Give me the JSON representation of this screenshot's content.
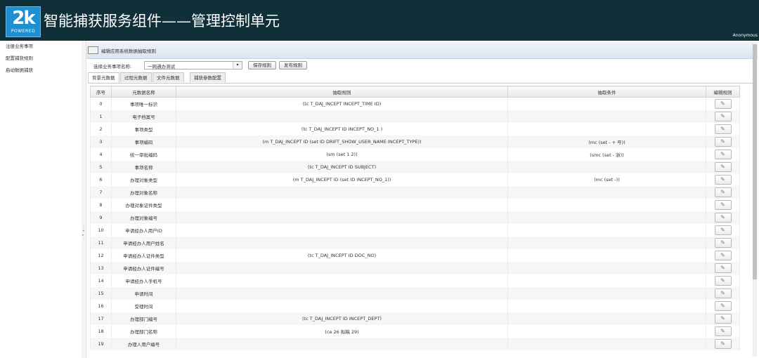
{
  "header": {
    "logo_mark": "2k",
    "logo_sub": "POWERED",
    "title": "智能捕获服务组件——管理控制单元",
    "user": "Anonymous"
  },
  "sidebar": {
    "items": [
      {
        "label": "注册业务事项"
      },
      {
        "label": "配置捕获规则"
      },
      {
        "label": "启动数据捕获"
      }
    ]
  },
  "panel": {
    "title": "编辑应用系统数据抽取规则"
  },
  "toolbar": {
    "select_label": "选择业务事项名称:",
    "select_value": "一网通办测试",
    "save_label": "保存规则",
    "publish_label": "发布规则"
  },
  "tabs": [
    {
      "label": "背景元数据",
      "active": true
    },
    {
      "label": "过程元数据",
      "active": false
    },
    {
      "label": "文件元数据",
      "active": false
    },
    {
      "label": "捕获参数配置",
      "active": false
    }
  ],
  "table": {
    "headers": [
      "序号",
      "元数据名称",
      "抽取规则",
      "抽取条件",
      "编辑规则"
    ],
    "edit_icon": "pencil-icon",
    "rows": [
      {
        "no": "0",
        "name": "事项唯一标识",
        "rule": "(tc T_DAJ_INCEPT INCEPT_TIME ID)",
        "cond": ""
      },
      {
        "no": "1",
        "name": "电子档案号",
        "rule": "",
        "cond": ""
      },
      {
        "no": "2",
        "name": "事项类型",
        "rule": "(tc T_DAJ_INCEPT ID INCEPT_NO_1 )",
        "cond": ""
      },
      {
        "no": "3",
        "name": "事项编码",
        "rule": "(m T_DAJ_INCEPT ID (set ID DRIFT_SHOW_USER_NAME INCEPT_TYPE))",
        "cond": "(mc (set - + 号))"
      },
      {
        "no": "4",
        "name": "统一审批编码",
        "rule": "(sm (set 1 2))",
        "cond": "(smc (set - 浙))"
      },
      {
        "no": "5",
        "name": "事项名称",
        "rule": "(tc T_DAJ_INCEPT ID SUBJECT)",
        "cond": ""
      },
      {
        "no": "6",
        "name": "办理对象类型",
        "rule": "(m T_DAJ_INCEPT ID (set ID INCEPT_NO_1))",
        "cond": "(mc (set -))"
      },
      {
        "no": "7",
        "name": "办理对象名称",
        "rule": "",
        "cond": ""
      },
      {
        "no": "8",
        "name": "办理对象证件类型",
        "rule": "",
        "cond": ""
      },
      {
        "no": "9",
        "name": "办理对象编号",
        "rule": "",
        "cond": ""
      },
      {
        "no": "10",
        "name": "申请经办人用户ID",
        "rule": "",
        "cond": ""
      },
      {
        "no": "11",
        "name": "申请经办人用户姓名",
        "rule": "",
        "cond": ""
      },
      {
        "no": "12",
        "name": "申请经办人证件类型",
        "rule": "(tc T_DAJ_INCEPT ID DOC_NO)",
        "cond": ""
      },
      {
        "no": "13",
        "name": "申请经办人证件编号",
        "rule": "",
        "cond": ""
      },
      {
        "no": "14",
        "name": "申请经办人手机号",
        "rule": "",
        "cond": ""
      },
      {
        "no": "15",
        "name": "申请时间",
        "rule": "",
        "cond": ""
      },
      {
        "no": "16",
        "name": "受理时间",
        "rule": "",
        "cond": ""
      },
      {
        "no": "17",
        "name": "办理部门编号",
        "rule": "(tc T_DAJ_INCEPT ID INCEPT_DEPT)",
        "cond": ""
      },
      {
        "no": "18",
        "name": "办理部门名称",
        "rule": "(ce 26 拟稿 29)",
        "cond": ""
      },
      {
        "no": "19",
        "name": "办理人用户编号",
        "rule": "",
        "cond": ""
      }
    ]
  }
}
